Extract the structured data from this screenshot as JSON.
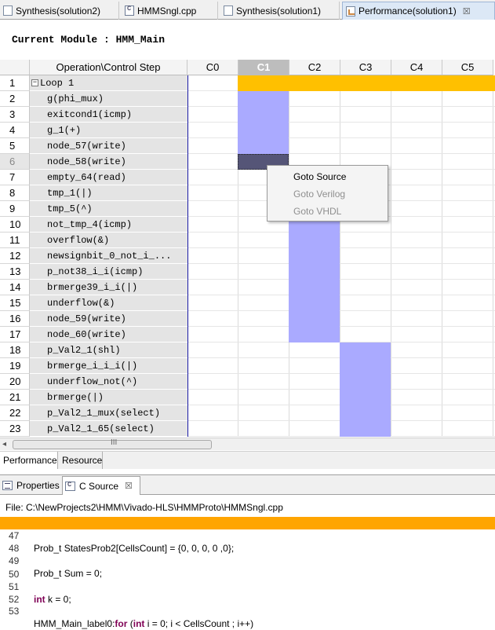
{
  "editor_tabs": [
    {
      "label": "Synthesis(solution2)",
      "icon": "report-icon"
    },
    {
      "label": "HMMSngl.cpp",
      "icon": "c-file-icon"
    },
    {
      "label": "Synthesis(solution1)",
      "icon": "report-icon"
    },
    {
      "label": "Performance(solution1)",
      "icon": "performance-icon",
      "active": true,
      "close": "☒"
    }
  ],
  "current_module": "Current Module : HMM_Main",
  "table": {
    "op_header": "Operation\\Control Step",
    "columns": [
      "C0",
      "C1",
      "C2",
      "C3",
      "C4",
      "C5"
    ],
    "selected_column": "C1",
    "rows": [
      {
        "num": "1",
        "op": "Loop 1",
        "expander": "−"
      },
      {
        "num": "2",
        "op": "g(phi_mux)"
      },
      {
        "num": "3",
        "op": "exitcond1(icmp)"
      },
      {
        "num": "4",
        "op": "g_1(+)"
      },
      {
        "num": "5",
        "op": "node_57(write)"
      },
      {
        "num": "6",
        "op": "node_58(write)"
      },
      {
        "num": "7",
        "op": "empty_64(read)"
      },
      {
        "num": "8",
        "op": "tmp_1(|)"
      },
      {
        "num": "9",
        "op": "tmp_5(^)"
      },
      {
        "num": "10",
        "op": "not_tmp_4(icmp)"
      },
      {
        "num": "11",
        "op": "overflow(&)"
      },
      {
        "num": "12",
        "op": "newsignbit_0_not_i_..."
      },
      {
        "num": "13",
        "op": "p_not38_i_i(icmp)"
      },
      {
        "num": "14",
        "op": "brmerge39_i_i(|)"
      },
      {
        "num": "15",
        "op": "underflow(&)"
      },
      {
        "num": "16",
        "op": "node_59(write)"
      },
      {
        "num": "17",
        "op": "node_60(write)"
      },
      {
        "num": "18",
        "op": "p_Val2_1(shl)"
      },
      {
        "num": "19",
        "op": "brmerge_i_i_i(|)"
      },
      {
        "num": "20",
        "op": "underflow_not(^)"
      },
      {
        "num": "21",
        "op": "brmerge(|)"
      },
      {
        "num": "22",
        "op": "p_Val2_1_mux(select)"
      },
      {
        "num": "23",
        "op": "p_Val2_1_65(select)"
      }
    ],
    "selected_row": "6",
    "colors": {
      "loop": "#ffc000",
      "op": "#aaaaff",
      "selected_op": "#555577"
    }
  },
  "context_menu": {
    "items": [
      {
        "label": "Goto Source",
        "enabled": true
      },
      {
        "label": "Goto Verilog",
        "enabled": false
      },
      {
        "label": "Goto VHDL",
        "enabled": false
      }
    ]
  },
  "scrollbar": {
    "left_arrow": "◂",
    "grip": "III"
  },
  "view_tabs": [
    {
      "label": "Performance",
      "active": true
    },
    {
      "label": "Resource"
    }
  ],
  "panel_tabs": [
    {
      "label": "Properties",
      "icon": "properties-icon"
    },
    {
      "label": "C Source",
      "icon": "c-file-icon",
      "active": true,
      "close": "☒"
    }
  ],
  "file_path": "File: C:\\NewProjects2\\HMM\\Vivado-HLS\\HMMProto\\HMMSngl.cpp",
  "code": [
    {
      "ln": "47",
      "text": "Prob_t StatesProb2[CellsCount] = {0, 0, 0, 0 ,0};",
      "highlight": true
    },
    {
      "ln": "48",
      "text": ""
    },
    {
      "ln": "49",
      "text": "Prob_t Sum = 0;"
    },
    {
      "ln": "50",
      "text": ""
    },
    {
      "ln": "51",
      "kw": "int",
      "text": " k = 0;"
    },
    {
      "ln": "52",
      "text": ""
    },
    {
      "ln": "53",
      "text": "HMM_Main_label0:",
      "kw2": "for",
      "text2": " (",
      "kw3": "int",
      "text3": " i = 0; i < CellsCount ; i++)"
    }
  ]
}
